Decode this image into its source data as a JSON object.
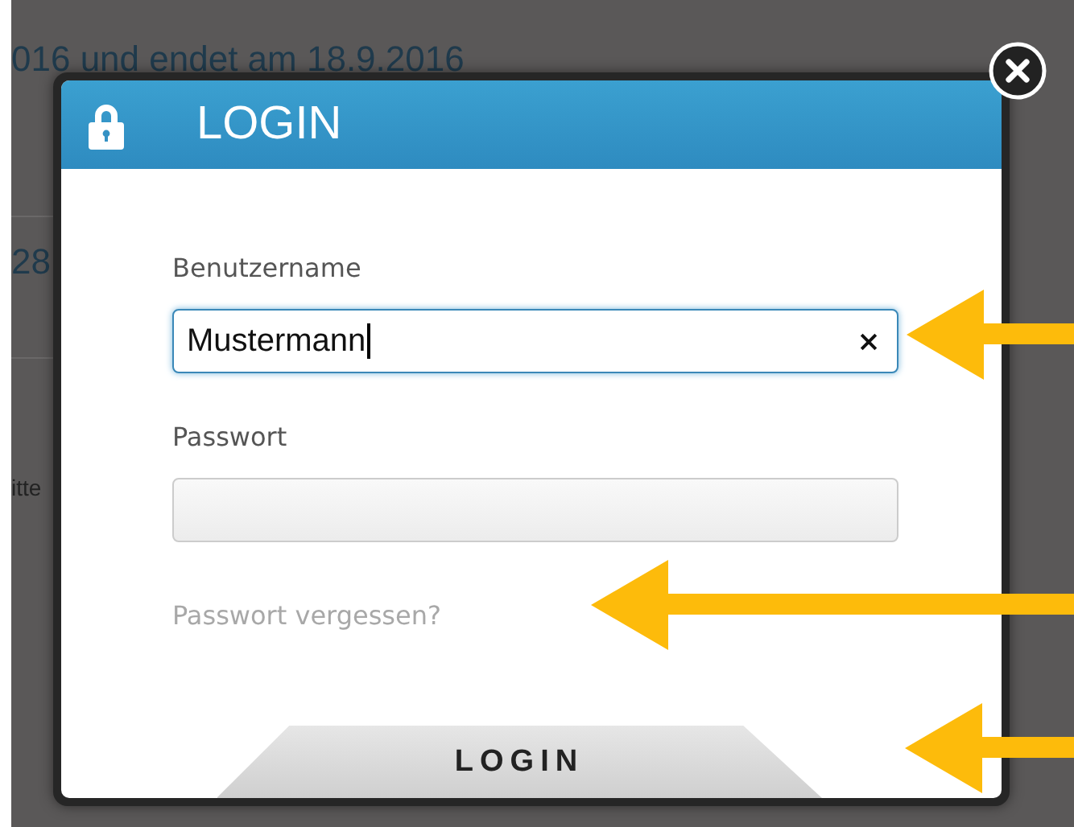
{
  "background": {
    "texts": [
      "016 und endet am 18.9.2016",
      "28",
      "itte"
    ]
  },
  "dialog": {
    "title": "LOGIN",
    "fields": [
      {
        "kind": "text",
        "label": "Benutzername",
        "value": "Mustermann",
        "focused": true
      },
      {
        "kind": "password",
        "label": "Passwort",
        "focused": false
      }
    ],
    "forgot_link": "Passwort vergessen?",
    "submit": "LOGIN"
  }
}
